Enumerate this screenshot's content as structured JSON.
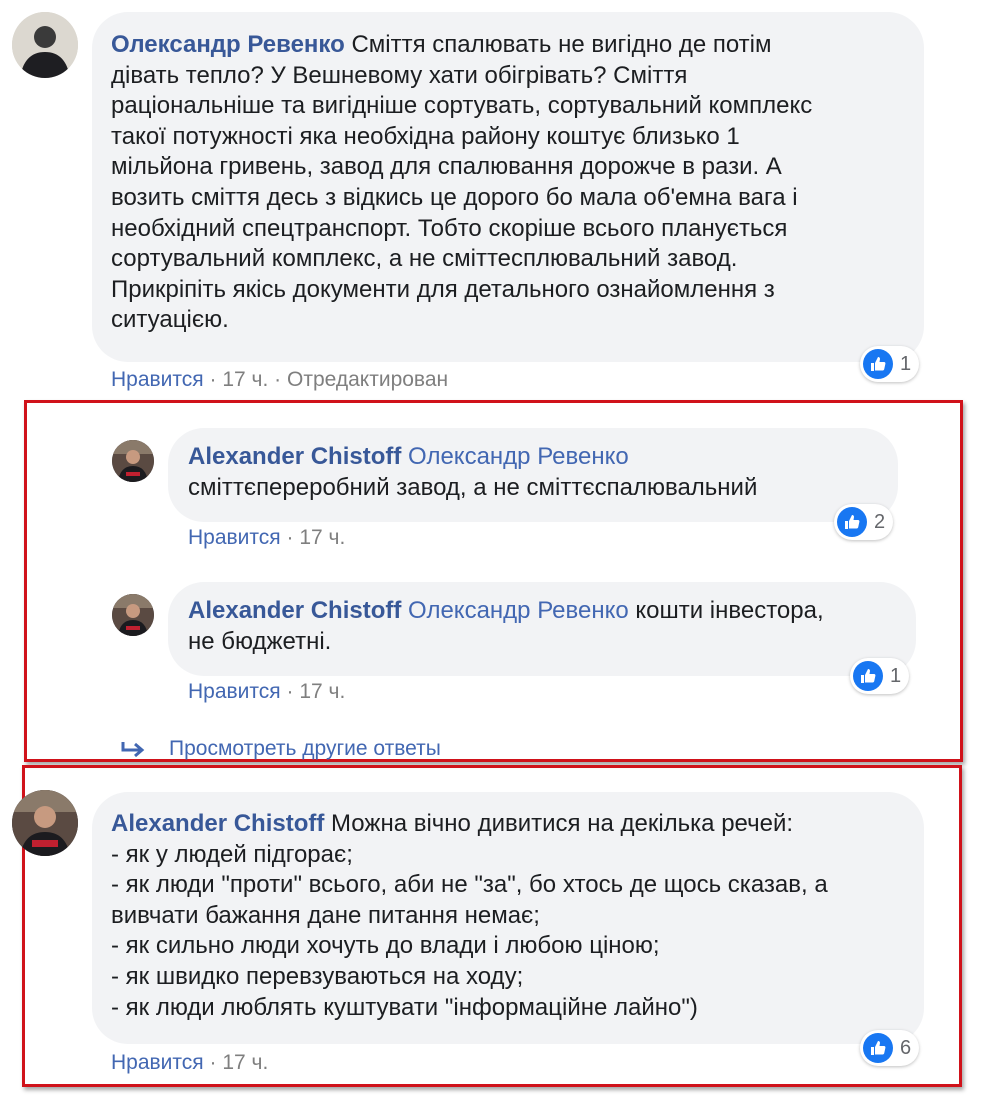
{
  "comments": [
    {
      "author": "Олександр Ревенко",
      "text": "Сміття спалювать не вигідно де потім\nдівать тепло? У Вешневому хати обігрівать? Сміття\nраціональніше та вигідніше сортувать, сортувальний комплекс\nтакої потужності яка необхідна району коштує близько 1\nмільйона гривень, завод для спалювання дорожче в рази. А\nвозить сміття десь з відкись це дорого бо мала об'емна вага і\nнеобхідний спецтранспорт. Тобто скоріше всього планується\nсортувальний комплекс, а не сміттесплювальний завод.\nПрикріпіть якісь документи для детального ознайомлення з\nситуацією.",
      "like_label": "Нравится",
      "time": "17 ч.",
      "edited": "Отредактирован",
      "reactions": "1"
    },
    {
      "author": "Alexander Chistoff",
      "mention": "Олександр Ревенко",
      "text": "сміттєпереробний завод, а не сміттєспалювальний",
      "like_label": "Нравится",
      "time": "17 ч.",
      "reactions": "2"
    },
    {
      "author": "Alexander Chistoff",
      "mention": "Олександр Ревенко",
      "text_inline": "кошти інвестора,",
      "text": "не бюджетні.",
      "like_label": "Нравится",
      "time": "17 ч.",
      "reactions": "1"
    },
    {
      "author": "Alexander Chistoff",
      "text_inline": "Можна вічно дивитися на декілька речей:",
      "text": "- як у людей підгорає;\n- як люди \"проти\" всього, аби не \"за\", бо хтось де щось сказав, а\nвивчати бажання дане питання немає;\n- як сильно люди хочуть до влади і любою ціною;\n- як швидко перевзуваються на ходу;\n- як люди люблять куштувати \"інформаційне лайно\")",
      "like_label": "Нравится",
      "time": "17 ч.",
      "reactions": "6"
    }
  ],
  "more_replies": "Просмотреть другие ответы",
  "separator": "·",
  "icons": {
    "like": "thumbs-up-icon",
    "reply": "reply-arrow-icon"
  },
  "colors": {
    "author": "#385898",
    "link": "#4267b2",
    "bubble": "#f2f3f5",
    "like_badge": "#1877f2",
    "highlight_border": "#d0121a"
  }
}
